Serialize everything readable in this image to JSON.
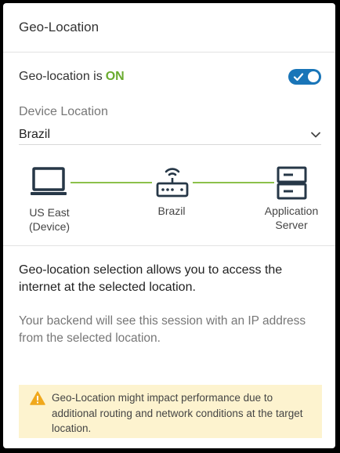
{
  "header": {
    "title": "Geo-Location"
  },
  "geo": {
    "label": "Geo-location is",
    "status": "ON",
    "toggle_state": "on",
    "toggle_color": "#1975b8",
    "status_color": "#6aab2f"
  },
  "device_location": {
    "label": "Device Location",
    "selected": "Brazil"
  },
  "diagram": {
    "nodes": [
      {
        "icon": "laptop-icon",
        "label_line1": "US East",
        "label_line2": "(Device)"
      },
      {
        "icon": "router-icon",
        "label_line1": "Brazil",
        "label_line2": ""
      },
      {
        "icon": "server-icon",
        "label_line1": "Application",
        "label_line2": "Server"
      }
    ],
    "link_color": "#8cc04b"
  },
  "description": {
    "main": "Geo-location selection allows you to access the internet at the selected location.",
    "sub": "Your backend will see this session with an IP address from the selected location."
  },
  "warning": {
    "icon": "warning-icon",
    "text": "Geo-Location might impact performance due to additional routing and network conditions at the target location.",
    "background": "#fdf3cf"
  }
}
